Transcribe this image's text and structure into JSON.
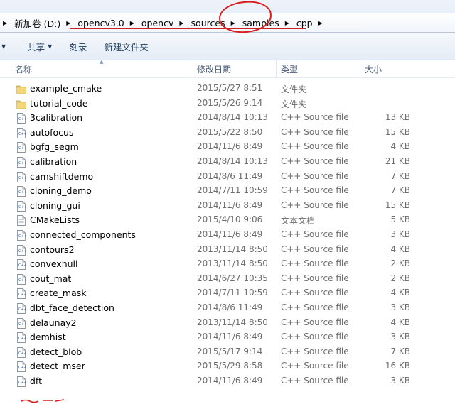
{
  "address_bar": {
    "crumbs": [
      {
        "label": "新加卷 (D:)"
      },
      {
        "label": "opencv3.0"
      },
      {
        "label": "opencv"
      },
      {
        "label": "sources"
      },
      {
        "label": "samples"
      },
      {
        "label": "cpp"
      }
    ]
  },
  "toolbar": {
    "share_label": "共享",
    "burn_label": "刻录",
    "new_folder_label": "新建文件夹"
  },
  "columns": {
    "name": "名称",
    "date": "修改日期",
    "type": "类型",
    "size": "大小"
  },
  "files": [
    {
      "name": "example_cmake",
      "date": "2015/5/27 8:51",
      "type": "文件夹",
      "size": "",
      "icon": "folder-icon"
    },
    {
      "name": "tutorial_code",
      "date": "2015/5/26 9:14",
      "type": "文件夹",
      "size": "",
      "icon": "folder-icon"
    },
    {
      "name": "3calibration",
      "date": "2014/8/14 10:13",
      "type": "C++ Source file",
      "size": "13 KB",
      "icon": "cpp-file-icon"
    },
    {
      "name": "autofocus",
      "date": "2015/5/22 8:50",
      "type": "C++ Source file",
      "size": "15 KB",
      "icon": "cpp-file-icon"
    },
    {
      "name": "bgfg_segm",
      "date": "2014/11/6 8:49",
      "type": "C++ Source file",
      "size": "4 KB",
      "icon": "cpp-file-icon"
    },
    {
      "name": "calibration",
      "date": "2014/8/14 10:13",
      "type": "C++ Source file",
      "size": "21 KB",
      "icon": "cpp-file-icon"
    },
    {
      "name": "camshiftdemo",
      "date": "2014/8/6 11:49",
      "type": "C++ Source file",
      "size": "7 KB",
      "icon": "cpp-file-icon"
    },
    {
      "name": "cloning_demo",
      "date": "2014/7/11 10:59",
      "type": "C++ Source file",
      "size": "7 KB",
      "icon": "cpp-file-icon"
    },
    {
      "name": "cloning_gui",
      "date": "2014/11/6 8:49",
      "type": "C++ Source file",
      "size": "15 KB",
      "icon": "cpp-file-icon"
    },
    {
      "name": "CMakeLists",
      "date": "2015/4/10 9:06",
      "type": "文本文档",
      "size": "5 KB",
      "icon": "text-file-icon"
    },
    {
      "name": "connected_components",
      "date": "2014/11/6 8:49",
      "type": "C++ Source file",
      "size": "3 KB",
      "icon": "cpp-file-icon"
    },
    {
      "name": "contours2",
      "date": "2013/11/14 8:50",
      "type": "C++ Source file",
      "size": "4 KB",
      "icon": "cpp-file-icon"
    },
    {
      "name": "convexhull",
      "date": "2013/11/14 8:50",
      "type": "C++ Source file",
      "size": "2 KB",
      "icon": "cpp-file-icon"
    },
    {
      "name": "cout_mat",
      "date": "2014/6/27 10:35",
      "type": "C++ Source file",
      "size": "2 KB",
      "icon": "cpp-file-icon"
    },
    {
      "name": "create_mask",
      "date": "2014/7/11 10:59",
      "type": "C++ Source file",
      "size": "4 KB",
      "icon": "cpp-file-icon"
    },
    {
      "name": "dbt_face_detection",
      "date": "2014/8/6 11:49",
      "type": "C++ Source file",
      "size": "3 KB",
      "icon": "cpp-file-icon"
    },
    {
      "name": "delaunay2",
      "date": "2013/11/14 8:50",
      "type": "C++ Source file",
      "size": "4 KB",
      "icon": "cpp-file-icon"
    },
    {
      "name": "demhist",
      "date": "2014/11/6 8:49",
      "type": "C++ Source file",
      "size": "3 KB",
      "icon": "cpp-file-icon"
    },
    {
      "name": "detect_blob",
      "date": "2015/5/17 9:14",
      "type": "C++ Source file",
      "size": "7 KB",
      "icon": "cpp-file-icon"
    },
    {
      "name": "detect_mser",
      "date": "2015/5/29 8:58",
      "type": "C++ Source file",
      "size": "16 KB",
      "icon": "cpp-file-icon"
    },
    {
      "name": "dft",
      "date": "2014/11/6 8:49",
      "type": "C++ Source file",
      "size": "3 KB",
      "icon": "cpp-file-icon"
    }
  ],
  "colors": {
    "annotation": "#d91e1e",
    "folder": "#e8c65a",
    "secondary_text": "#6d6d6d"
  }
}
